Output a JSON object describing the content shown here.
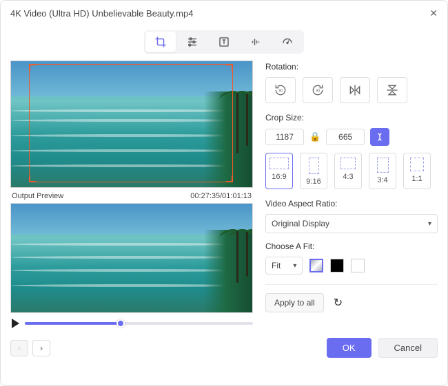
{
  "window": {
    "title": "4K Video (Ultra HD) Unbelievable Beauty.mp4"
  },
  "toolbar": {
    "tools": {
      "crop": "crop",
      "adjust": "adjust",
      "text": "text",
      "audio": "audio",
      "speed": "speed"
    }
  },
  "preview": {
    "output_label": "Output Preview",
    "time": "00:27:35/01:01:13"
  },
  "rotation": {
    "label": "Rotation:",
    "buttons": {
      "left": "rotate-left-90",
      "right": "rotate-right-90",
      "fliph": "flip-horizontal",
      "flipv": "flip-vertical"
    }
  },
  "crop": {
    "label": "Crop Size:",
    "width": "1187",
    "height": "665",
    "aspects": {
      "a169": "16:9",
      "a916": "9:16",
      "a43": "4:3",
      "a34": "3:4",
      "a11": "1:1"
    }
  },
  "aspect_ratio": {
    "label": "Video Aspect Ratio:",
    "value": "Original Display"
  },
  "fit": {
    "label": "Choose A Fit:",
    "value": "Fit"
  },
  "apply": {
    "label": "Apply to all"
  },
  "footer": {
    "ok": "OK",
    "cancel": "Cancel"
  }
}
